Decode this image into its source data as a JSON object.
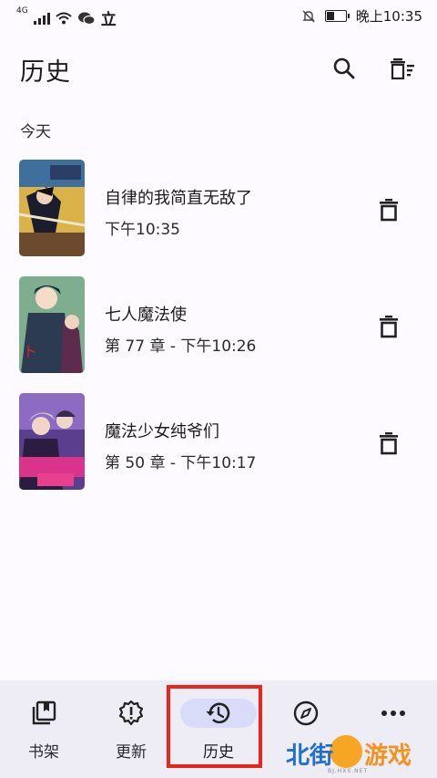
{
  "status_bar": {
    "network": "4G",
    "carrier_glyph": "立",
    "time": "晚上10:35"
  },
  "header": {
    "title": "历史",
    "search_icon": "search-icon",
    "clear_history_icon": "clear-all-icon"
  },
  "section": {
    "label": "今天"
  },
  "history": [
    {
      "title": "自律的我简直无敌了",
      "subtitle": "下午10:35"
    },
    {
      "title": "七人魔法使",
      "subtitle": "第 77 章 - 下午10:26"
    },
    {
      "title": "魔法少女纯爷们",
      "subtitle": "第 50 章 - 下午10:17"
    }
  ],
  "nav": {
    "items": [
      {
        "label": "书架",
        "icon": "library-icon"
      },
      {
        "label": "更新",
        "icon": "updates-icon"
      },
      {
        "label": "历史",
        "icon": "history-icon",
        "active": true
      },
      {
        "label": "",
        "icon": "compass-icon"
      },
      {
        "label": "",
        "icon": "more-icon"
      }
    ]
  },
  "watermark": {
    "text_left": "北街",
    "text_right": "游戏",
    "url": "BJ.HXS.NET"
  },
  "colors": {
    "background": "#fdfbff",
    "nav_background": "#eeecf5",
    "active_indicator": "#d9dcf8",
    "highlight_box": "#e8261b"
  }
}
